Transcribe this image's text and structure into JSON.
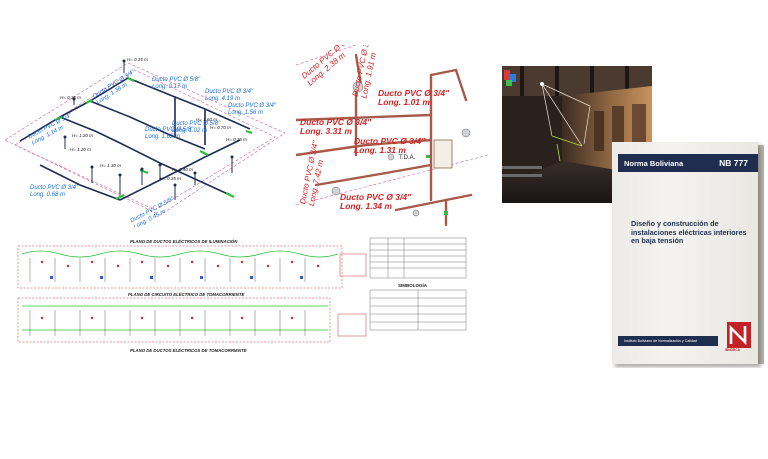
{
  "iso_left": {
    "ducts": [
      {
        "name": "Ducto PVC Ø 3/4\"",
        "length": "Long. 1.38 m"
      },
      {
        "name": "Ducto PVC Ø 5/8\"",
        "length": "Long. 0.17 m"
      },
      {
        "name": "Ducto PVC Ø 3/4\"",
        "length": "Long. 4.19 m"
      },
      {
        "name": "Ducto PVC Ø 3/4\"",
        "length": "Long. 1.56 m"
      },
      {
        "name": "Ducto PVC Ø 5/8\"",
        "length": "Long. 1.02 m"
      },
      {
        "name": "Ducto PVC Ø 5/8\"",
        "length": "Long. 1.62 m"
      },
      {
        "name": "Ducto PVC Ø 3/4\"",
        "length": "Long. 0.68 m"
      },
      {
        "name": "Ducto PVC Ø 3/4\"",
        "length": "Long. 1.14 m"
      },
      {
        "name": "Ducto PVC Ø 5/8\"",
        "length": "Long. 0.45 m"
      }
    ],
    "heights": [
      "H= 0.35 m",
      "H= 1.20 m",
      "H= 1.30 m",
      "H= 0.70 m",
      "H= 1.60 m",
      "H= 0.35 m",
      "H= 0.35 m",
      "H= 0.40 m",
      "H= 1.20 m",
      "H= 0.35 m"
    ]
  },
  "iso_right": {
    "ducts": [
      {
        "name": "Ducto PVC Ø 3/4\"",
        "length": "Long. 2.38 m"
      },
      {
        "name": "Ducto PVC Ø 3/4\"",
        "length": "Long. 1.91 m"
      },
      {
        "name": "Ducto PVC Ø 3/4\"",
        "length": "Long. 1.01 m"
      },
      {
        "name": "Ducto PVC Ø 3/4\"",
        "length": "Long. 3.31 m"
      },
      {
        "name": "Ducto PVC Ø 3/4\"",
        "length": "Long. 1.31 m"
      },
      {
        "name": "Ducto PVC Ø 3/4\"",
        "length": "Long. 1.34 m"
      },
      {
        "name": "Ducto PVC Ø 3/4\"",
        "length": "Long. 7.42 m"
      }
    ],
    "panel_label": "T.D.A."
  },
  "plans": {
    "title_lighting": "PLANO DE DUCTOS ELÉCTRICOS DE ILUMINACIÓN",
    "title_circuit": "PLANO DE CIRCUITO ELÉCTRICO DE TOMACORRIENTE",
    "title_outlet": "PLANO DE DUCTOS ELÉCTRICOS DE TOMACORRIENTE",
    "legend_title": "SIMBOLOGÍA"
  },
  "book": {
    "org": "Norma Boliviana",
    "code": "NB 777",
    "title": "Diseño y construcción de instalaciones eléctricas interiores en baja tensión",
    "footer": "Instituto Boliviano de Normalización y Calidad",
    "logo_text": "IBNORCA"
  },
  "colors": {
    "duct_blue": "#1b6fd8",
    "duct_red": "#d42323",
    "book_navy": "#1f2d4e",
    "logo_red": "#c42127"
  }
}
